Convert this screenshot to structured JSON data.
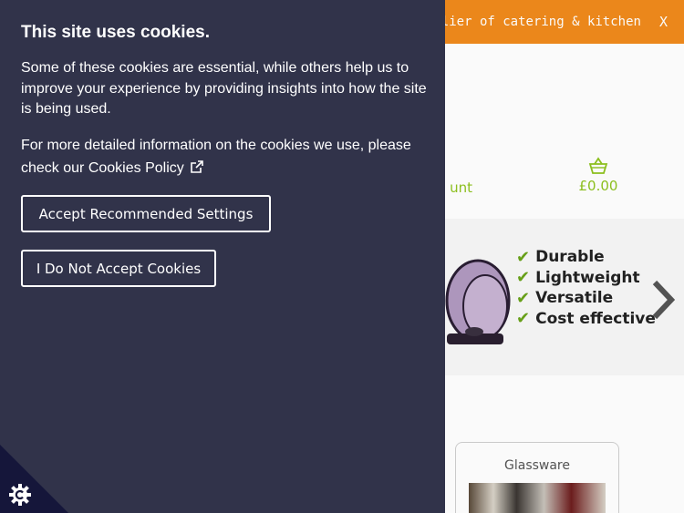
{
  "site": {
    "announcement": "supplier of catering & kitchen",
    "announcement_close": "X",
    "account_label": "unt",
    "basket_total": "£0.00",
    "features": [
      {
        "label": "Durable"
      },
      {
        "label": "Lightweight"
      },
      {
        "label": "Versatile"
      },
      {
        "label": "Cost effective"
      }
    ],
    "category_card": {
      "title": "Glassware"
    }
  },
  "cookie_banner": {
    "title": "This site uses cookies.",
    "paragraph1": "Some of these cookies are essential, while others help us to improve your experience by providing insights into how the site is being used.",
    "paragraph2_prefix": "For more detailed information on the cookies we use, please check our",
    "policy_link": "Cookies Policy",
    "accept_button": "Accept Recommended Settings",
    "decline_button": "I Do Not Accept Cookies"
  },
  "colors": {
    "panel_bg": "#31334a",
    "topbar_bg": "#f08a1c",
    "accent_green": "#8fc31f",
    "corner_bg": "#15163a"
  },
  "icons": {
    "basket": "basket-icon",
    "external_link": "external-link-icon",
    "next": "chevron-right-icon",
    "cookie_settings": "gear-icon",
    "check": "check-icon"
  }
}
